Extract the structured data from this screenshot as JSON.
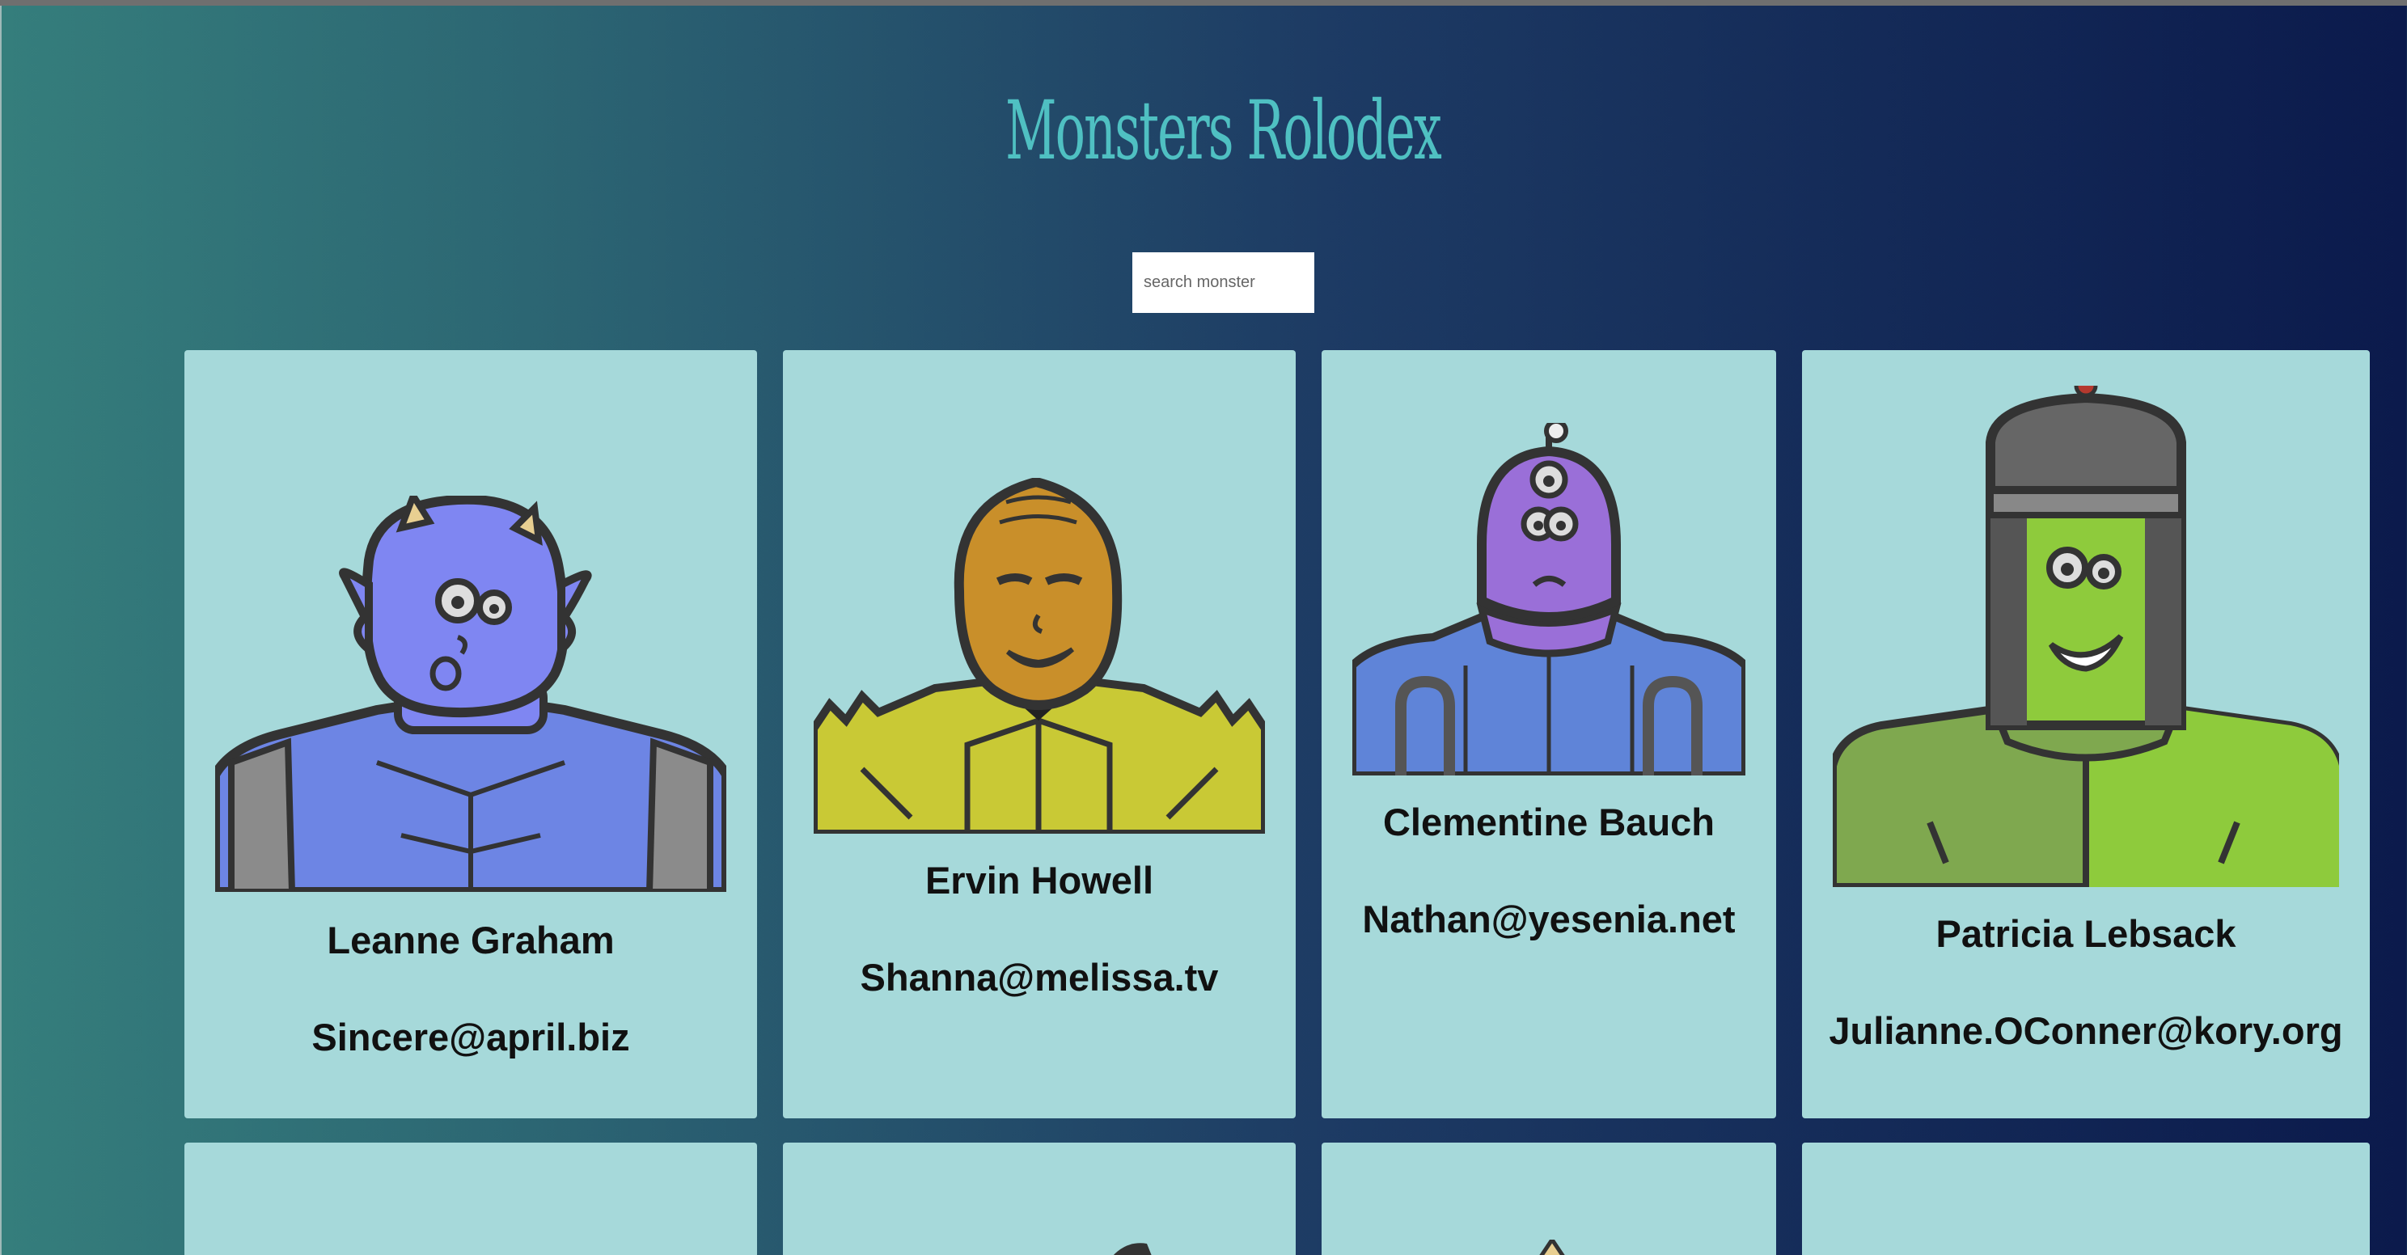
{
  "header": {
    "title": "Monsters Rolodex"
  },
  "search": {
    "placeholder": "search monster"
  },
  "monsters": [
    {
      "name": "Leanne Graham",
      "email": "Sincere@april.biz",
      "color": "#7f86f2",
      "type": "horned-monster-icon"
    },
    {
      "name": "Ervin Howell",
      "email": "Shanna@melissa.tv",
      "color": "#c98f2a",
      "type": "gold-mask-monster-icon"
    },
    {
      "name": "Clementine Bauch",
      "email": "Nathan@yesenia.net",
      "color": "#9a6fd8",
      "type": "cyclops-robot-monster-icon"
    },
    {
      "name": "Patricia Lebsack",
      "email": "Julianne.OConner@kory.org",
      "color": "#8ecb3c",
      "type": "frankenstein-monster-icon"
    }
  ]
}
